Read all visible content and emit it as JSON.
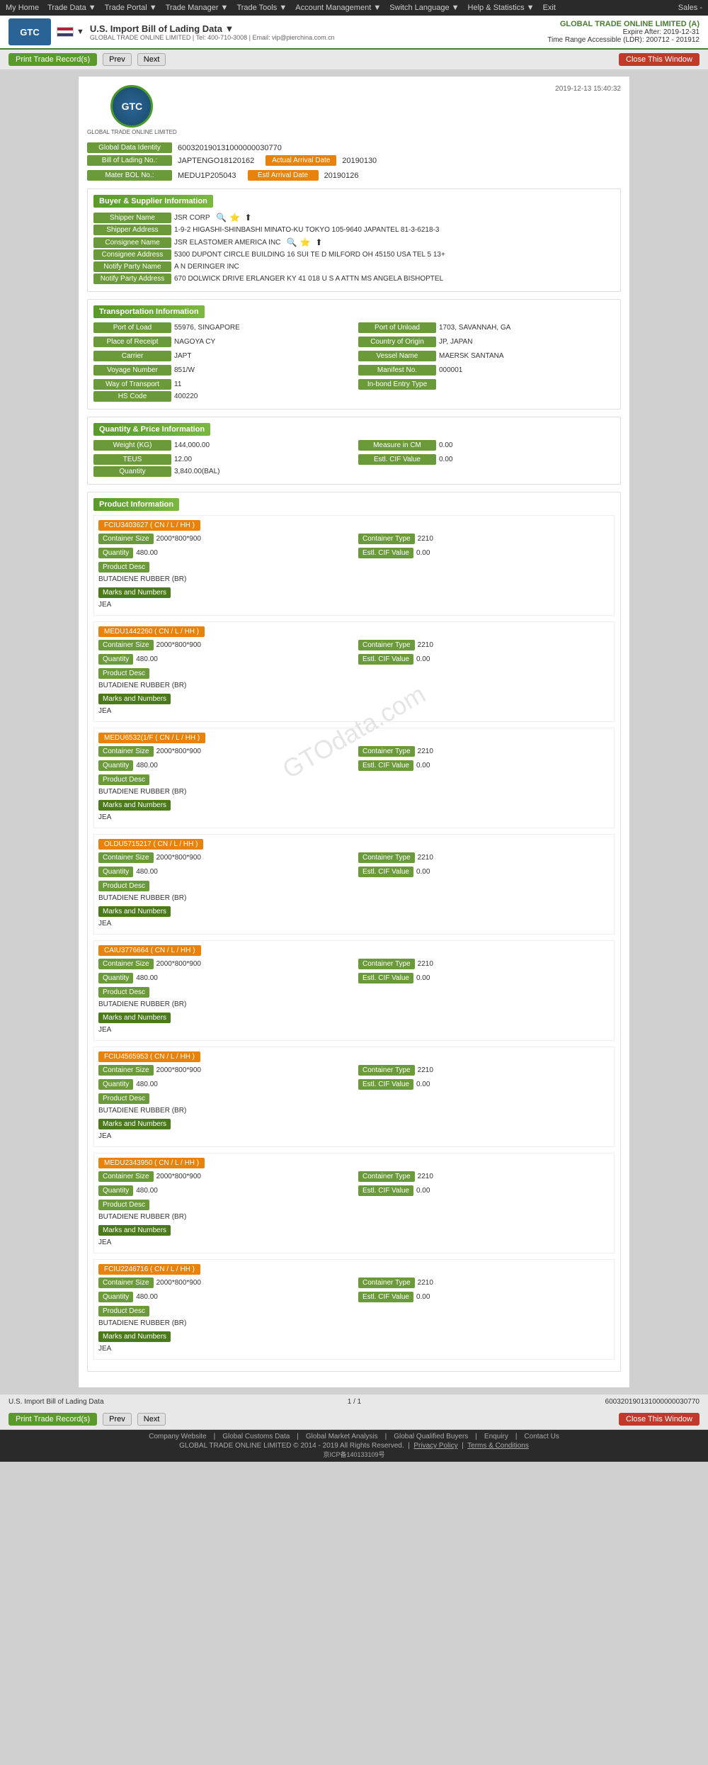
{
  "nav": {
    "items": [
      "My Home",
      "Trade Data",
      "Trade Portal",
      "Trade Manager",
      "Trade Tools",
      "Account Management",
      "Switch Language",
      "Help & Statistics",
      "Exit"
    ],
    "right": "Sales"
  },
  "logo_bar": {
    "logo_text": "GTC",
    "subtitle": "GLOBAL TRADE ONLINE LIMITED | Tel: 400-710-3008 | Email: vip@pierchina.com.cn",
    "company": "GLOBAL TRADE ONLINE LIMITED (A)",
    "expire": "Expire After: 2019-12-31",
    "time_range": "Time Range Accessible (LDR): 200712 - 201912",
    "page_title": "U.S. Import Bill of Lading Data ▼"
  },
  "toolbar": {
    "print_label": "Print Trade Record(s)",
    "prev_label": "Prev",
    "next_label": "Next",
    "close_label": "Close This Window"
  },
  "doc": {
    "date": "2019-12-13 15:40:32",
    "gtc_name": "GTC",
    "global_data_identity": "600320190131000000030770",
    "bill_of_lading_no": "JAPTENGO18120162",
    "mater_bol_no": "MEDU1P205043",
    "actual_arrival_date_label": "Actual Arrival Date",
    "actual_arrival_date": "20190130",
    "estl_arrival_date_label": "Estl Arrival Date",
    "estl_arrival_date": "20190126"
  },
  "buyer_supplier": {
    "section_title": "Buyer & Supplier Information",
    "shipper_name_label": "Shipper Name",
    "shipper_name": "JSR CORP",
    "shipper_address_label": "Shipper Address",
    "shipper_address": "1-9-2 HIGASHI-SHINBASHI MINATO-KU TOKYO 105-9640 JAPANTEL 81-3-6218-3",
    "consignee_name_label": "Consignee Name",
    "consignee_name": "JSR ELASTOMER AMERICA INC",
    "consignee_address_label": "Consignee Address",
    "consignee_address": "5300 DUPONT CIRCLE BUILDING 16 SUI TE D MILFORD OH 45150 USA TEL 5 13+",
    "notify_party_label": "Notify Party Name",
    "notify_party": "A N DERINGER INC",
    "notify_party_address_label": "Notify Party Address",
    "notify_party_address": "670 DOLWICK DRIVE ERLANGER KY 41 018 U S A ATTN MS ANGELA BISHOPTEL"
  },
  "transportation": {
    "section_title": "Transportation Information",
    "port_of_load_label": "Port of Load",
    "port_of_load": "55976, SINGAPORE",
    "port_of_unload_label": "Port of Unload",
    "port_of_unload": "1703, SAVANNAH, GA",
    "place_of_receipt_label": "Place of Receipt",
    "place_of_receipt": "NAGOYA CY",
    "country_of_origin_label": "Country of Origin",
    "country_of_origin": "JP, JAPAN",
    "carrier_label": "Carrier",
    "carrier": "JAPT",
    "vessel_name_label": "Vessel Name",
    "vessel_name": "MAERSK SANTANA",
    "voyage_number_label": "Voyage Number",
    "voyage_number": "851/W",
    "manifest_no_label": "Manifest No.",
    "manifest_no": "000001",
    "way_of_transport_label": "Way of Transport",
    "way_of_transport": "11",
    "inbond_entry_type_label": "In-bond Entry Type",
    "inbond_entry_type": "",
    "hs_code_label": "HS Code",
    "hs_code": "400220"
  },
  "quantity": {
    "section_title": "Quantity & Price Information",
    "weight_label": "Weight (KG)",
    "weight": "144,000.00",
    "measure_label": "Measure in CM",
    "measure": "0.00",
    "teus_label": "TEUS",
    "teus": "12.00",
    "estl_cif_label": "Estl. CIF Value",
    "estl_cif": "0.00",
    "quantity_label": "Quantity",
    "quantity": "3,840.00(BAL)"
  },
  "product": {
    "section_title": "Product Information",
    "containers": [
      {
        "container_number": "FCIU3403627 ( CN / L / HH )",
        "container_size_label": "Container Size",
        "container_size": "2000*800*900",
        "container_type_label": "Container Type",
        "container_type": "2210",
        "quantity_label": "Quantity",
        "quantity": "480.00",
        "estl_cif_label": "Estl. CIF Value",
        "estl_cif": "0.00",
        "product_desc_label": "Product Desc",
        "product_desc": "BUTADIENE RUBBER (BR)",
        "marks_label": "Marks and Numbers",
        "marks": "JEA"
      },
      {
        "container_number": "MEDU1442260 ( CN / L / HH )",
        "container_size_label": "Container Size",
        "container_size": "2000*800*900",
        "container_type_label": "Container Type",
        "container_type": "2210",
        "quantity_label": "Quantity",
        "quantity": "480.00",
        "estl_cif_label": "Estl. CIF Value",
        "estl_cif": "0.00",
        "product_desc_label": "Product Desc",
        "product_desc": "BUTADIENE RUBBER (BR)",
        "marks_label": "Marks and Numbers",
        "marks": "JEA"
      },
      {
        "container_number": "MEDU6532(1/F ( CN / L / HH )",
        "container_size_label": "Container Size",
        "container_size": "2000*800*900",
        "container_type_label": "Container Type",
        "container_type": "2210",
        "quantity_label": "Quantity",
        "quantity": "480.00",
        "estl_cif_label": "Estl. CIF Value",
        "estl_cif": "0.00",
        "product_desc_label": "Product Desc",
        "product_desc": "BUTADIENE RUBBER (BR)",
        "marks_label": "Marks and Numbers",
        "marks": "JEA"
      },
      {
        "container_number": "OLDU5715217 ( CN / L / HH )",
        "container_size_label": "Container Size",
        "container_size": "2000*800*900",
        "container_type_label": "Container Type",
        "container_type": "2210",
        "quantity_label": "Quantity",
        "quantity": "480.00",
        "estl_cif_label": "Estl. CIF Value",
        "estl_cif": "0.00",
        "product_desc_label": "Product Desc",
        "product_desc": "BUTADIENE RUBBER (BR)",
        "marks_label": "Marks and Numbers",
        "marks": "JEA"
      },
      {
        "container_number": "CAIU3776664 ( CN / L / HH )",
        "container_size_label": "Container Size",
        "container_size": "2000*800*900",
        "container_type_label": "Container Type",
        "container_type": "2210",
        "quantity_label": "Quantity",
        "quantity": "480.00",
        "estl_cif_label": "Estl. CIF Value",
        "estl_cif": "0.00",
        "product_desc_label": "Product Desc",
        "product_desc": "BUTADIENE RUBBER (BR)",
        "marks_label": "Marks and Numbers",
        "marks": "JEA"
      },
      {
        "container_number": "FCIU4565953 ( CN / L / HH )",
        "container_size_label": "Container Size",
        "container_size": "2000*800*900",
        "container_type_label": "Container Type",
        "container_type": "2210",
        "quantity_label": "Quantity",
        "quantity": "480.00",
        "estl_cif_label": "Estl. CIF Value",
        "estl_cif": "0.00",
        "product_desc_label": "Product Desc",
        "product_desc": "BUTADIENE RUBBER (BR)",
        "marks_label": "Marks and Numbers",
        "marks": "JEA"
      },
      {
        "container_number": "MEDU2343950 ( CN / L / HH )",
        "container_size_label": "Container Size",
        "container_size": "2000*800*900",
        "container_type_label": "Container Type",
        "container_type": "2210",
        "quantity_label": "Quantity",
        "quantity": "480.00",
        "estl_cif_label": "Estl. CIF Value",
        "estl_cif": "0.00",
        "product_desc_label": "Product Desc",
        "product_desc": "BUTADIENE RUBBER (BR)",
        "marks_label": "Marks and Numbers",
        "marks": "JEA"
      },
      {
        "container_number": "FCIU2246716 ( CN / L / HH )",
        "container_size_label": "Container Size",
        "container_size": "2000*800*900",
        "container_type_label": "Container Type",
        "container_type": "2210",
        "quantity_label": "Quantity",
        "quantity": "480.00",
        "estl_cif_label": "Estl. CIF Value",
        "estl_cif": "0.00",
        "product_desc_label": "Product Desc",
        "product_desc": "BUTADIENE RUBBER (BR)",
        "marks_label": "Marks and Numbers",
        "marks": "JEA"
      }
    ]
  },
  "page_footer": {
    "doc_name": "U.S. Import Bill of Lading Data",
    "page_info": "1 / 1",
    "record_id": "600320190131000000030770"
  },
  "bottom": {
    "links": [
      "Company Website",
      "Global Customs Data",
      "Global Market Analysis",
      "Global Qualified Buyers",
      "Enquiry",
      "Contact Us"
    ],
    "copyright": "GLOBAL TRADE ONLINE LIMITED © 2014 - 2019 All Rights Reserved.",
    "privacy": "Privacy Policy",
    "terms": "Terms & Conditions",
    "icp": "京ICP备140133109号"
  }
}
